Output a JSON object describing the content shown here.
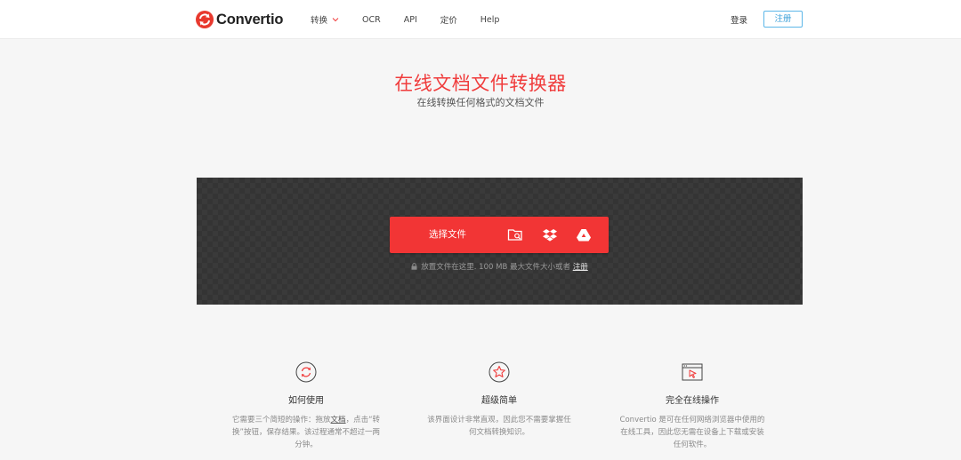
{
  "header": {
    "logo_text": "Convertio",
    "nav": [
      {
        "label": "转换",
        "has_dropdown": true
      },
      {
        "label": "OCR"
      },
      {
        "label": "API"
      },
      {
        "label": "定价"
      },
      {
        "label": "Help"
      }
    ],
    "login_label": "登录",
    "signup_label": "注册"
  },
  "hero": {
    "title": "在线文档文件转换器",
    "subtitle": "在线转换任何格式的文档文件"
  },
  "uploader": {
    "choose_label": "选择文件",
    "source_icons": [
      "folder-search-icon",
      "dropbox-icon",
      "google-drive-icon"
    ],
    "hint_text": "放置文件在这里. 100 MB 最大文件大小或者 ",
    "hint_link": "注册"
  },
  "features": [
    {
      "icon": "refresh-icon",
      "title": "如何使用",
      "desc_pre": "它需要三个简短的操作：拖放",
      "desc_link": "文档",
      "desc_post": "，点击“转换”按钮，保存结果。该过程通常不超过一两分钟。"
    },
    {
      "icon": "star-icon",
      "title": "超级简单",
      "desc": "该界面设计非常直观，因此您不需要掌握任何文档转换知识。"
    },
    {
      "icon": "browser-cursor-icon",
      "title": "完全在线操作",
      "desc": "Convertio 是可在任何网络浏览器中使用的在线工具，因此您无需在设备上下载或安装任何软件。"
    }
  ],
  "colors": {
    "brand_red": "#f23535",
    "title_red": "#f03c3c",
    "signup_blue": "#3a9fd8",
    "dropzone_bg": "#343434"
  }
}
